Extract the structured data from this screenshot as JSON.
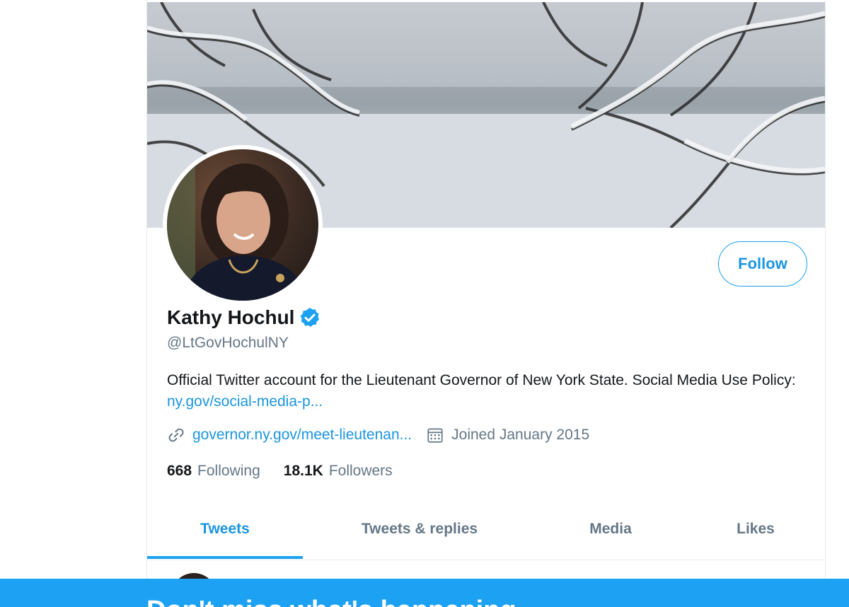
{
  "profile": {
    "display_name": "Kathy Hochul",
    "handle": "@LtGovHochulNY",
    "bio_text": "Official Twitter account for the Lieutenant Governor of New York State. Social Media Use Policy: ",
    "bio_link": "ny.gov/social-media-p...",
    "website": "governor.ny.gov/meet-lieutenan...",
    "joined": "Joined January 2015",
    "following_count": "668",
    "following_label": "Following",
    "followers_count": "18.1K",
    "followers_label": "Followers"
  },
  "actions": {
    "follow_label": "Follow"
  },
  "tabs": [
    {
      "label": "Tweets",
      "active": true
    },
    {
      "label": "Tweets & replies",
      "active": false
    },
    {
      "label": "Media",
      "active": false
    },
    {
      "label": "Likes",
      "active": false
    }
  ],
  "bottom_banner": {
    "text": "Don't miss what's happening"
  },
  "colors": {
    "accent": "#1da1f2",
    "link": "#1b95e0",
    "secondary_text": "#657786",
    "primary_text": "#14171a"
  },
  "icons": {
    "verified": "verified-badge-icon",
    "website": "link-icon",
    "joined": "calendar-icon"
  }
}
